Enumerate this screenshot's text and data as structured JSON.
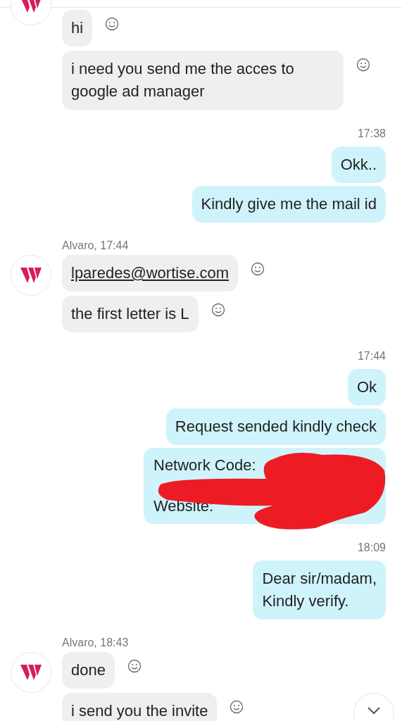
{
  "groups": [
    {
      "kind": "incoming",
      "messages": [
        {
          "text": "hi",
          "reaction": true
        },
        {
          "text": "i need you send me the acces to google ad manager",
          "reaction": true
        }
      ]
    },
    {
      "kind": "outgoing",
      "time": "17:38",
      "messages": [
        {
          "text": "Okk.."
        },
        {
          "text": "Kindly give me the mail id"
        }
      ]
    },
    {
      "kind": "incoming",
      "header": "Alvaro, 17:44",
      "messages": [
        {
          "text": "lparedes@wortise.com",
          "link": true,
          "reaction": true
        },
        {
          "text": "the first letter is L",
          "reaction": true
        }
      ]
    },
    {
      "kind": "outgoing",
      "time": "17:44",
      "messages": [
        {
          "text": "Ok"
        },
        {
          "text": "Request sended kindly check"
        },
        {
          "lines": [
            "Network Code:",
            "Website:"
          ],
          "redacted": true
        }
      ]
    },
    {
      "kind": "outgoing",
      "time": "18:09",
      "messages": [
        {
          "text": "Dear sir/madam,\nKindly verify."
        }
      ]
    },
    {
      "kind": "incoming",
      "header": "Alvaro, 18:43",
      "messages": [
        {
          "text": "done",
          "reaction": true
        },
        {
          "text": "i send you the invite",
          "reaction": true
        }
      ]
    }
  ]
}
